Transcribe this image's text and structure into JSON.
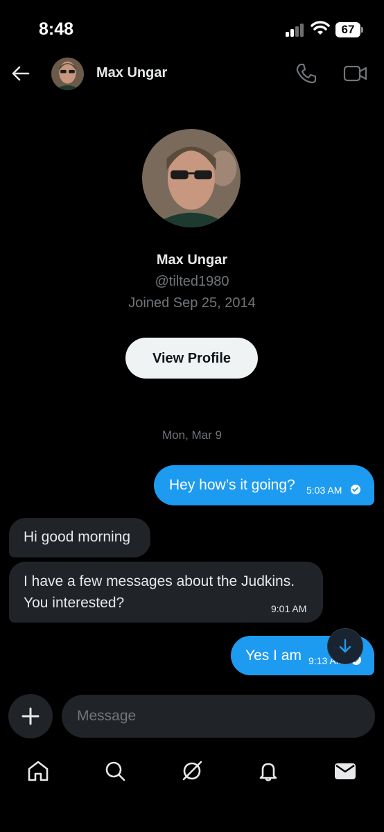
{
  "status_bar": {
    "time": "8:48",
    "battery": "67"
  },
  "header": {
    "name": "Max Ungar"
  },
  "profile": {
    "name": "Max Ungar",
    "handle": "@tilted1980",
    "joined": "Joined Sep 25, 2014",
    "view_profile_label": "View Profile"
  },
  "conversation": {
    "date": "Mon, Mar 9",
    "messages": [
      {
        "direction": "out",
        "text": "Hey how’s it going?",
        "time": "5:03 AM"
      },
      {
        "direction": "in",
        "text": "Hi good morning"
      },
      {
        "direction": "in",
        "text_line1": "I have a few messages about the Judkins.",
        "text_line2": "You interested?",
        "time": "9:01 AM"
      },
      {
        "direction": "out",
        "text": "Yes I am",
        "time": "9:13 AM"
      }
    ]
  },
  "composer": {
    "placeholder": "Message"
  },
  "colors": {
    "accent": "#1d9bf0",
    "background": "#000000",
    "incoming_bubble": "#202327"
  },
  "icons": [
    "back-arrow-icon",
    "phone-icon",
    "video-camera-icon",
    "plus-icon",
    "arrow-down-icon",
    "home-icon",
    "search-icon",
    "grok-icon",
    "bell-icon",
    "mail-icon"
  ]
}
